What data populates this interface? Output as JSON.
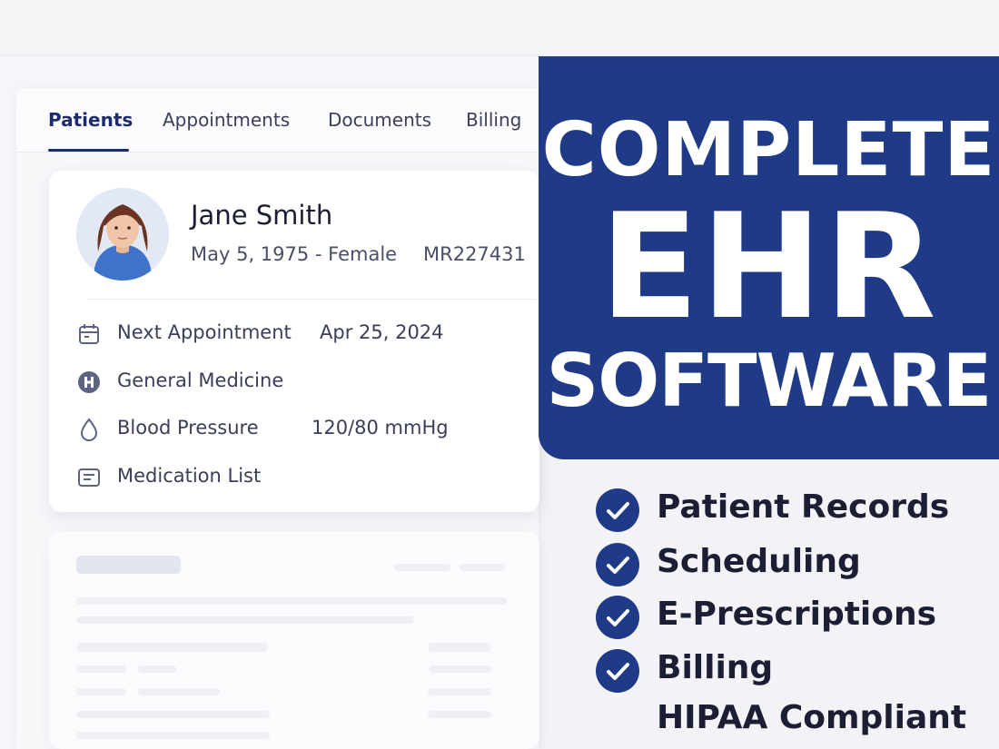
{
  "tabs": [
    "Patients",
    "Appointments",
    "Documents",
    "Billing"
  ],
  "patient": {
    "name": "Jane Smith",
    "dob_sex": "May 5, 1975 - Female",
    "mrn": "MR227431"
  },
  "details": {
    "next_appointment_label": "Next Appointment",
    "next_appointment_value": "Apr 25, 2024",
    "department": "General Medicine",
    "blood_pressure_label": "Blood Pressure",
    "blood_pressure_value": "120/80 mmHg",
    "medication_list": "Medication List"
  },
  "promo": {
    "line1": "COMPLETE",
    "line2": "EHR",
    "line3": "SOFTWARE"
  },
  "features": [
    "Patient Records",
    "Scheduling",
    "E-Prescriptions",
    "Billing",
    "HIPAA Compliant"
  ],
  "colors": {
    "brand": "#1f3a86",
    "tab_active": "#1d2b6b",
    "card": "#ffffff",
    "background": "#f3f3f7"
  },
  "icons": [
    "calendar-icon",
    "hospital-icon",
    "blood-drop-icon",
    "document-list-icon",
    "check-circle-icon"
  ]
}
